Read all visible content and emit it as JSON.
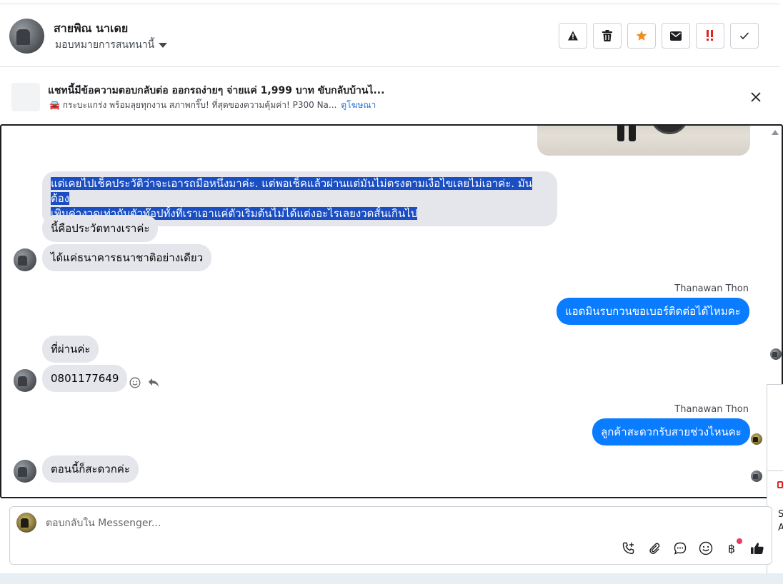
{
  "header": {
    "contact_name": "สายพิณ นาเดย",
    "assign_label": "มอบหมายการสนทนานี้",
    "actions": [
      {
        "name": "report-icon",
        "color": "#1c1e21"
      },
      {
        "name": "trash-icon",
        "color": "#1c1e21"
      },
      {
        "name": "star-icon",
        "color": "#f28c22"
      },
      {
        "name": "mail-icon",
        "color": "#1c1e21"
      },
      {
        "name": "important-icon",
        "color": "#e02424"
      },
      {
        "name": "check-icon",
        "color": "#1c1e21"
      }
    ]
  },
  "ad_banner": {
    "title": "แชทนี้มีข้อความตอบกลับต่อ ออกรถง่ายๆ จ่ายแค่ 1,999 บาท ขับกลับบ้านไ...",
    "subtitle": "🚘 กระบะแกร่ง พร้อมลุยทุกงาน สภาพกริ๊บ! ที่สุดของความคุ้มค่า! P300 Na...",
    "link": "ดูโฆษณา"
  },
  "messages": [
    {
      "id": "m1",
      "line1": "แต่เคยไปเช็คประวัติว่าจะเอารถมือหนึ่งมาค่ะ. แต่พอเช็คแล้วผ่านแต่มันไม่ตรงตามเงื่อไขเลยไม่เอาค่ะ. มันต้อง",
      "line2": "เพิ่มค่างวดเท่ากับตัวท๊อปทั้งที่เราเอาแค่ตัวเริ่มต้นไม่ได้แต่งอะไรเลยงวดสั้นเกินไป"
    },
    {
      "id": "m2",
      "text": "นี้คือประวัตทางเราค่ะ"
    },
    {
      "id": "m3",
      "text": "ได้แค่ธนาคารธนาชาติอย่างเดียว"
    },
    {
      "id": "m4",
      "sender": "Thanawan Thon",
      "text": "แอดมินรบกวนขอเบอร์ติดต่อได้ไหมคะ"
    },
    {
      "id": "m5",
      "text": "ที่ผ่านค่ะ"
    },
    {
      "id": "m6",
      "text": "0801177649"
    },
    {
      "id": "m7",
      "sender": "Thanawan Thon",
      "text": "ลูกค้าสะดวกรับสายช่วงไหนคะ"
    },
    {
      "id": "m8",
      "text": "ตอนนี้ก็สะดวกค่ะ"
    }
  ],
  "composer": {
    "placeholder": "ตอบกลับใน Messenger...",
    "baht_symbol": "฿"
  },
  "side_fragments": [
    "S",
    "A"
  ]
}
